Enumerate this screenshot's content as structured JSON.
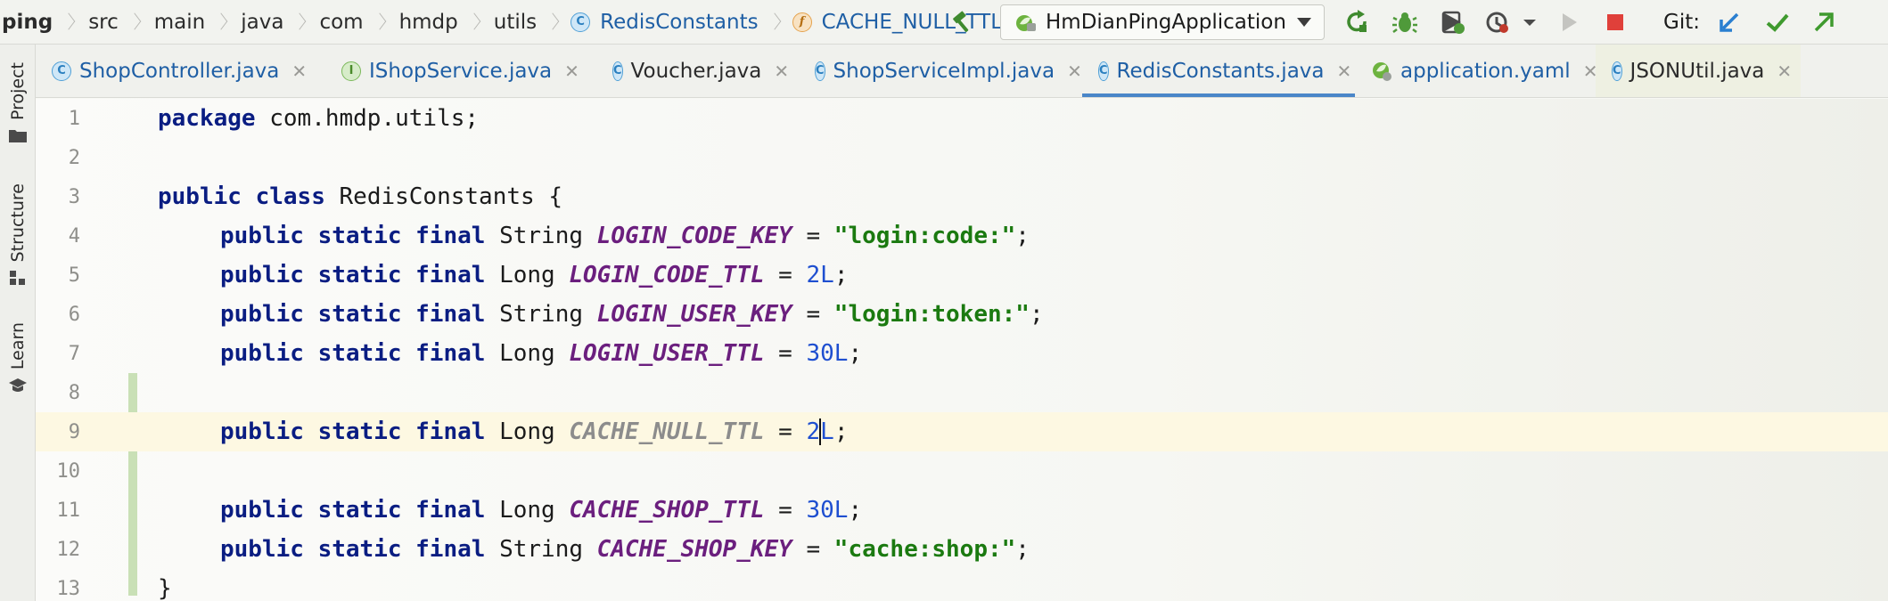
{
  "breadcrumb": {
    "items": [
      "ping",
      "src",
      "main",
      "java",
      "com",
      "hmdp",
      "utils",
      "RedisConstants",
      "CACHE_NULL_TTL"
    ]
  },
  "toolbar": {
    "run_config": "HmDianPingApplication",
    "git_label": "Git:",
    "icons": [
      "build-hammer-icon",
      "rerun-icon",
      "debug-icon",
      "coverage-icon",
      "profile-icon",
      "run-icon",
      "stop-icon",
      "git-update-icon",
      "git-commit-icon",
      "git-push-icon"
    ]
  },
  "left_strip": {
    "project": "Project",
    "structure": "Structure",
    "learn": "Learn"
  },
  "tabs": [
    {
      "label": "ShopController.java",
      "icon": "C"
    },
    {
      "label": "IShopService.java",
      "icon": "I"
    },
    {
      "label": "Voucher.java",
      "icon": "C"
    },
    {
      "label": "ShopServiceImpl.java",
      "icon": "C"
    },
    {
      "label": "RedisConstants.java",
      "icon": "C"
    },
    {
      "label": "application.yaml",
      "icon": "yaml"
    },
    {
      "label": "JSONUtil.java",
      "icon": "C"
    }
  ],
  "editor": {
    "line_numbers": [
      "1",
      "2",
      "3",
      "4",
      "5",
      "6",
      "7",
      "8",
      "9",
      "10",
      "11",
      "12",
      "13"
    ],
    "lines": {
      "l1_kw": "package",
      "l1_rest": " com.hmdp.utils;",
      "l3_kw1": "public",
      "l3_kw2": "class",
      "l3_rest": " RedisConstants {",
      "kw_public": "public",
      "kw_static": "static",
      "kw_final": "final",
      "t_string": "String",
      "t_long": "Long",
      "l4_name": "LOGIN_CODE_KEY",
      "l4_val": "\"login:code:\"",
      "l5_name": "LOGIN_CODE_TTL",
      "l5_val": "2L",
      "l6_name": "LOGIN_USER_KEY",
      "l6_val": "\"login:token:\"",
      "l7_name": "LOGIN_USER_TTL",
      "l7_val": "30L",
      "l9_name": "CACHE_NULL_TTL",
      "l9_val_a": "2",
      "l9_val_b": "L",
      "l11_name": "CACHE_SHOP_TTL",
      "l11_val": "30L",
      "l12_name": "CACHE_SHOP_KEY",
      "l12_val": "\"cache:shop:\"",
      "l13": "}",
      "eq": " = ",
      "semi": ";"
    }
  },
  "colors": {
    "keyword": "#0a1d82",
    "constant": "#6b1f7e",
    "string": "#1b7a10",
    "number": "#1f4fd0",
    "current_line": "#fdf8e2",
    "active_tab_underline": "#4a86c8"
  }
}
